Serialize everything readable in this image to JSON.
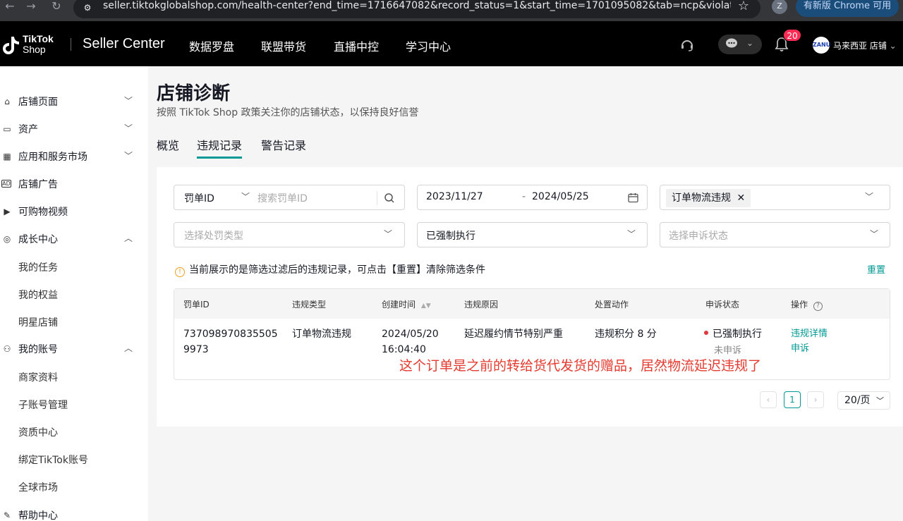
{
  "browser": {
    "url": "seller.tiktokglobalshop.com/health-center?end_time=1716647082&record_status=1&start_time=1701095082&tab=ncp&violation...",
    "profile_initial": "Z",
    "update_label": "有新版 Chrome 可用"
  },
  "header": {
    "logo_line1": "TikTok",
    "logo_line2": "Shop",
    "seller_center": "Seller Center",
    "nav": [
      "数据罗盘",
      "联盟带货",
      "直播中控",
      "学习中心"
    ],
    "notification_count": "20",
    "shop_name": "马来西亚 店铺",
    "shop_avatar_text": "ZANU"
  },
  "sidebar": {
    "items": [
      {
        "label": "店铺页面",
        "icon": "store-page-icon",
        "expanded": false
      },
      {
        "label": "资产",
        "icon": "wallet-icon",
        "expanded": false
      },
      {
        "label": "应用和服务市场",
        "icon": "apps-icon",
        "expanded": false
      },
      {
        "label": "店铺广告",
        "icon": "ad-icon"
      },
      {
        "label": "可购物视频",
        "icon": "video-icon"
      },
      {
        "label": "成长中心",
        "icon": "growth-icon",
        "expanded": true
      },
      {
        "label": "我的账号",
        "icon": "user-icon",
        "expanded": true
      },
      {
        "label": "帮助中心",
        "icon": "help-icon"
      }
    ],
    "growth_sub": [
      "我的任务",
      "我的权益",
      "明星店铺"
    ],
    "account_sub": [
      "商家资料",
      "子账号管理",
      "资质中心",
      "绑定TikTok账号",
      "全球市场"
    ]
  },
  "page": {
    "title": "店铺诊断",
    "subtitle": "按照 TikTok Shop 政策关注你的店铺状态，以保持良好信誉",
    "tabs": [
      "概览",
      "违规记录",
      "警告记录"
    ],
    "active_tab": 1
  },
  "filters": {
    "id_type": "罚单ID",
    "search_placeholder": "搜索罚单ID",
    "date_start": "2023/11/27",
    "date_sep": "-",
    "date_end": "2024/05/25",
    "violation_tag": "订单物流违规",
    "penalty_type_placeholder": "选择处罚类型",
    "status": "已强制执行",
    "appeal_placeholder": "选择申诉状态"
  },
  "notice": {
    "text": "当前展示的是筛选过滤后的违规记录，可点击【重置】清除筛选条件",
    "reset": "重置"
  },
  "table": {
    "columns": [
      "罚单ID",
      "违规类型",
      "创建时间",
      "违规原因",
      "处置动作",
      "申诉状态",
      "操作"
    ],
    "rows": [
      {
        "id_line1": "737098970835505",
        "id_line2": "9973",
        "type": "订单物流违规",
        "date": "2024/05/20",
        "time": "16:04:40",
        "reason": "延迟履约情节特别严重",
        "action": "违规积分 8 分",
        "status": "已强制执行",
        "appeal": "未申诉",
        "op_details": "违规详情",
        "op_appeal": "申诉"
      }
    ]
  },
  "annotation": "这个订单是之前的转给货代发货的赠品，居然物流延迟违规了",
  "pagination": {
    "current": "1",
    "page_size": "20/页"
  },
  "colors": {
    "accent": "#009995",
    "danger": "#fe2c55",
    "annotation": "#e53a2f"
  }
}
